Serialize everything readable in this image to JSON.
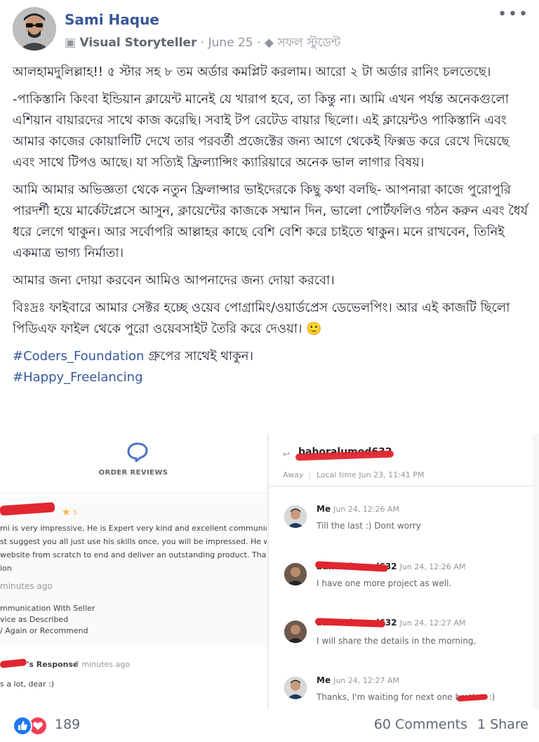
{
  "author": {
    "name": "Sami Haque",
    "role": "Visual Storyteller",
    "date": "June 25",
    "tag": "সফল স্টুডেন্ট"
  },
  "post": {
    "p1": "আলহামদুলিল্লাহ!! ৫ স্টার সহ ৮ তম অর্ডার কমপ্লিট করলাম। আরো ২ টা অর্ডার রানিং চলতেছে।",
    "p2": "-পাকিস্তানি কিংবা ইন্ডিয়ান ক্লায়েন্ট মানেই যে খারাপ হবে, তা কিন্তু না। আমি এখন পর্যন্ত অনেকগুলো এশিয়ান বায়ারদের সাথে কাজ করেছি। সবাই টপ রেটেড বায়ার ছিলো। এই ক্লায়েন্টও পাকিস্তানি এবং আমার কাজের কোয়ালিটি দেখে তার পরবর্তী প্রজেক্টের জন্য আগে থেকেই ফিক্সড করে রেখে দিয়েছে এবং সাথে টিপও আছে। যা সত্যিই ফ্রিল্যান্সিং ক্যারিয়ারে অনেক ভাল লাগার বিষয়।",
    "p3": "আমি আমার অভিজ্ঞতা থেকে নতুন ফ্রিলান্সার ভাইদেরকে কিছু কথা বলছি- আপনারা কাজে পুরোপুরি পারদর্শী হয়ে মার্কেটপ্লেসে আসুন, ক্লায়েন্টের কাজকে সম্মান দিন, ভালো পোর্টফলিও গঠন করুন এবং ধৈর্য ধরে লেগে থাকুন। আর সর্বোপরি আল্লাহর কাছে বেশি বেশি করে চাইতে থাকুন। মনে রাখবেন, তিনিই একমাত্র ভাগ্য নির্মাতা।",
    "p4": "আমার জন্য দোয়া করবেন আমিও আপনাদের জন্য দোয়া করবো।",
    "p5": "বিঃদ্রঃ ফাইবারে আমার সেক্টর হচ্ছে ওয়েব পোগ্রামিং/ওয়ার্ডপ্রেস ডেভেলপিং। আর এই কাজটি ছিলো পিডিএফ ফাইল থেকে পুরো ওয়েবসাইট তৈরি করে দেওয়া। 🙂",
    "hashtag1": "#Coders_Foundation",
    "hashtag1_suffix": " গ্রুপের সাথেই থাকুন।",
    "hashtag2": "#Happy_Freelancing"
  },
  "review_image": {
    "title": "ORDER REVIEWS",
    "review_lines": [
      "mi is very impressive, He is Expert very kind and excellent communicator. I",
      "st suggest you all just use his skills once, you will be impressed. He work",
      "website from scratch to end and deliver an outstanding product. Thanks a",
      "ion"
    ],
    "review_time": "minutes ago",
    "criteria": [
      "mmunication With Seller",
      "vice as Described",
      "/ Again or Recommend"
    ],
    "response_label": "'s Response",
    "response_time": "7 minutes ago",
    "response_text": "s a lot, dear :)",
    "star_value": "5"
  },
  "chat_image": {
    "contact_name": "bahoralumod632",
    "status": "Away",
    "local_time": "Local time Jun 23, 11:41 PM",
    "messages": [
      {
        "sender": "Me",
        "time": "Jun 24, 12:26 AM",
        "text": "Till the last :) Dont worry"
      },
      {
        "sender": "bahoralumod632",
        "time": "Jun 24, 12:26 AM",
        "text": "I have one more project as well."
      },
      {
        "sender": "bahoralumod632",
        "time": "Jun 24, 12:27 AM",
        "text": "I will share the details in the morning,"
      },
      {
        "sender": "Me",
        "time": "Jun 24, 12:27 AM",
        "text": "Thanks, I'm waiting for next one brother :)"
      }
    ]
  },
  "footer": {
    "reactions": "189",
    "comments": "60 Comments",
    "shares": "1 Share"
  }
}
